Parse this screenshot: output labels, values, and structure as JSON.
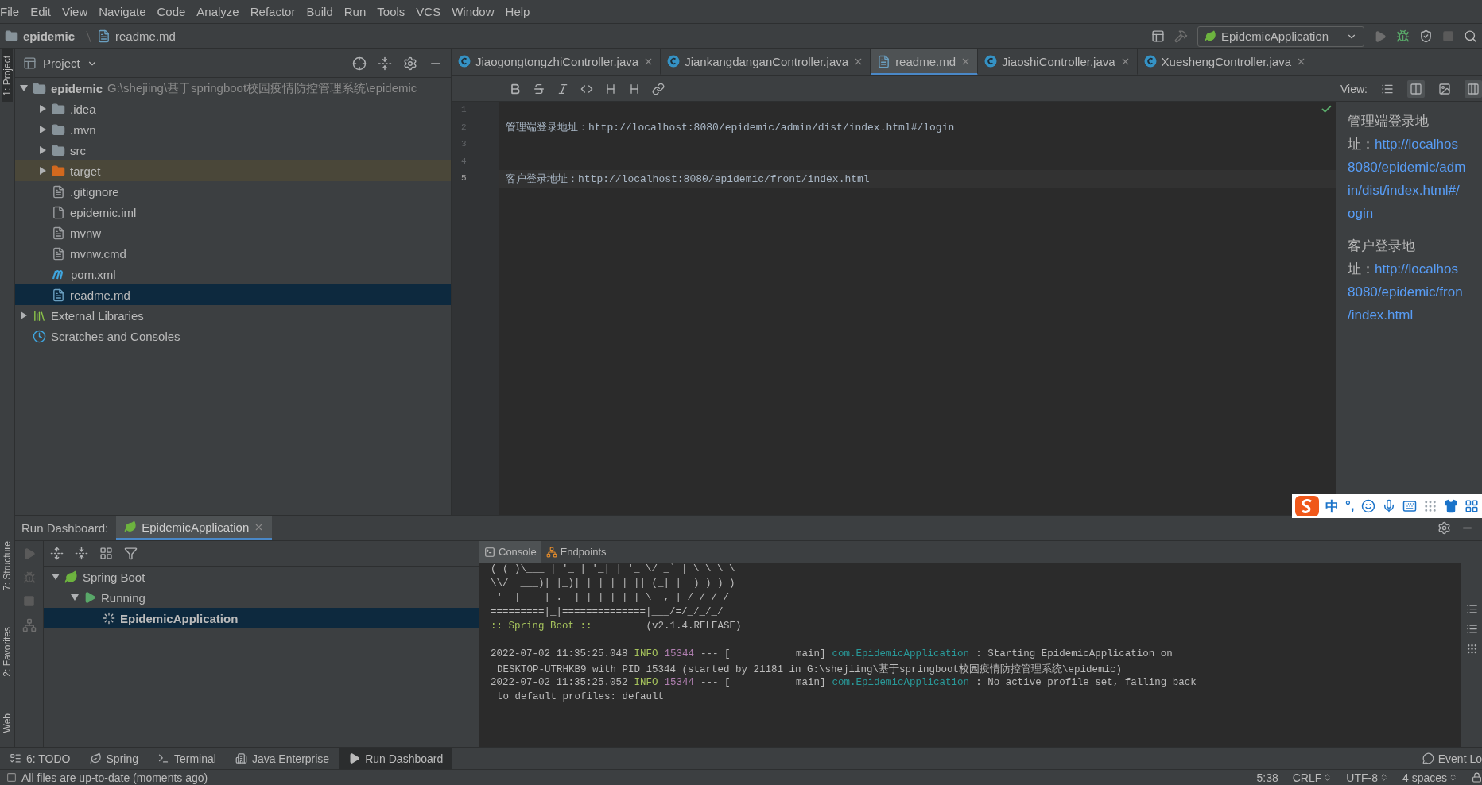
{
  "menu": [
    "File",
    "Edit",
    "View",
    "Navigate",
    "Code",
    "Analyze",
    "Refactor",
    "Build",
    "Run",
    "Tools",
    "VCS",
    "Window",
    "Help"
  ],
  "breadcrumb": [
    {
      "label": "epidemic",
      "kind": "module"
    },
    {
      "label": "readme.md",
      "kind": "markdown"
    }
  ],
  "run_config": {
    "label": "EpidemicApplication"
  },
  "left_stripe": {
    "top": [
      {
        "label": "1: Project",
        "selected": true
      }
    ],
    "bottom": [
      {
        "label": "7: Structure",
        "selected": false
      },
      {
        "label": "2: Favorites",
        "selected": false
      },
      {
        "label": "Web",
        "selected": false
      }
    ]
  },
  "project": {
    "title": "Project",
    "tree": [
      {
        "label": "epidemic",
        "path": "G:\\shejiing\\基于springboot校园疫情防控管理系统\\epidemic",
        "kind": "module",
        "expanded": true,
        "selected": false,
        "children": [
          {
            "label": ".idea",
            "kind": "folder",
            "expanded": false,
            "selected": false
          },
          {
            "label": ".mvn",
            "kind": "folder",
            "expanded": false,
            "selected": false
          },
          {
            "label": "src",
            "kind": "folder",
            "expanded": false,
            "selected": false
          },
          {
            "label": "target",
            "kind": "excluded-folder",
            "expanded": false,
            "selected": false
          },
          {
            "label": ".gitignore",
            "kind": "file",
            "selected": false
          },
          {
            "label": "epidemic.iml",
            "kind": "iml",
            "selected": false
          },
          {
            "label": "mvnw",
            "kind": "file",
            "selected": false
          },
          {
            "label": "mvnw.cmd",
            "kind": "file",
            "selected": false
          },
          {
            "label": "pom.xml",
            "kind": "maven",
            "selected": false
          },
          {
            "label": "readme.md",
            "kind": "markdown",
            "selected": true
          }
        ]
      },
      {
        "label": "External Libraries",
        "kind": "libraries",
        "expanded": false,
        "selected": false
      },
      {
        "label": "Scratches and Consoles",
        "kind": "scratches",
        "selected": false
      }
    ]
  },
  "editor": {
    "tabs": [
      {
        "label": "JiaogongtongzhiController.java",
        "kind": "class",
        "selected": false
      },
      {
        "label": "JiankangdanganController.java",
        "kind": "class",
        "selected": false
      },
      {
        "label": "readme.md",
        "kind": "markdown",
        "selected": true
      },
      {
        "label": "JiaoshiController.java",
        "kind": "class",
        "selected": false
      },
      {
        "label": "XueshengController.java",
        "kind": "class",
        "selected": false
      }
    ],
    "view_label": "View:",
    "lines": [
      {
        "number": "1",
        "current": false
      },
      {
        "number": "2",
        "text": "管理端登录地址：http://localhost:8080/epidemic/admin/dist/index.html#/login",
        "current": false
      },
      {
        "number": "3",
        "current": false
      },
      {
        "number": "4",
        "current": false
      },
      {
        "number": "5",
        "text": "客户登录地址：http://localhost:8080/epidemic/front/index.html",
        "current": true
      }
    ]
  },
  "preview": {
    "paragraphs": [
      {
        "lines": [
          [
            {
              "text": "管理端登录地",
              "link": false
            }
          ],
          [
            {
              "text": "址：",
              "link": false
            },
            {
              "text": "http://localhos",
              "link": true
            }
          ],
          [
            {
              "text": "8080/epidemic/adm",
              "link": true
            }
          ],
          [
            {
              "text": "in/dist/index.html#/",
              "link": true
            }
          ],
          [
            {
              "text": "ogin",
              "link": true
            }
          ]
        ]
      },
      {
        "lines": [
          [
            {
              "text": "客户登录地",
              "link": false
            }
          ],
          [
            {
              "text": "址：",
              "link": false
            },
            {
              "text": "http://localhos",
              "link": true
            }
          ],
          [
            {
              "text": "8080/epidemic/fron",
              "link": true
            }
          ],
          [
            {
              "text": "/index.html",
              "link": true
            }
          ]
        ]
      }
    ]
  },
  "ime": {
    "mode": "中",
    "punct": "°,"
  },
  "run_dashboard": {
    "title": "Run Dashboard:",
    "tabs": [
      {
        "label": "EpidemicApplication",
        "selected": true
      }
    ],
    "tree": [
      {
        "label": "Spring Boot",
        "kind": "spring",
        "expanded": true,
        "selected": false,
        "children": [
          {
            "label": "Running",
            "kind": "running",
            "expanded": true,
            "selected": false,
            "children": [
              {
                "label": "EpidemicApplication",
                "kind": "app",
                "selected": true
              }
            ]
          }
        ]
      }
    ],
    "console_tabs": [
      {
        "label": "Console",
        "kind": "console",
        "selected": true
      },
      {
        "label": "Endpoints",
        "kind": "endpoints",
        "selected": false
      }
    ],
    "console": {
      "banner": [
        {
          "segments": [
            {
              "text": "( ( )\\___ | '_ | '_| | '_ \\/ _` | \\ \\ \\ \\",
              "kind": "banner"
            }
          ]
        },
        {
          "segments": [
            {
              "text": "\\\\/  ___)| |_)| | | | | || (_| |  ) ) ) )",
              "kind": "banner"
            }
          ]
        },
        {
          "segments": [
            {
              "text": " '  |____| .__|_| |_|_| |_\\__, | / / / /",
              "kind": "banner"
            }
          ]
        },
        {
          "segments": [
            {
              "text": "=========|_|==============|___/=/_/_/_/",
              "kind": "banner"
            }
          ]
        },
        {
          "segments": [
            {
              "text": ":: Spring Boot ::",
              "kind": "spring"
            },
            {
              "text": "        (v2.1.4.RELEASE)",
              "kind": "banner"
            }
          ]
        }
      ],
      "log": [
        {
          "segments": [
            {
              "text": "2022-07-02 11:35:25.048",
              "kind": "timestamp"
            },
            {
              "text": "INFO",
              "kind": "level"
            },
            {
              "text": "15344",
              "kind": "pid"
            },
            {
              "text": "--- [           main]",
              "kind": "plain"
            },
            {
              "text": "com.EpidemicApplication",
              "kind": "logger"
            },
            {
              "text": ": Starting EpidemicApplication on",
              "kind": "message"
            }
          ]
        },
        {
          "segments": [
            {
              "text": "DESKTOP-UTRHKB9 with PID 15344 (started by 21181 in G:\\shejiing\\基于springboot校园疫情防控管理系统\\epidemic)",
              "kind": "continuation"
            }
          ]
        },
        {
          "segments": [
            {
              "text": "2022-07-02 11:35:25.052",
              "kind": "timestamp"
            },
            {
              "text": "INFO",
              "kind": "level"
            },
            {
              "text": "15344",
              "kind": "pid"
            },
            {
              "text": "--- [           main]",
              "kind": "plain"
            },
            {
              "text": "com.EpidemicApplication",
              "kind": "logger"
            },
            {
              "text": ": No active profile set, falling back",
              "kind": "message"
            }
          ]
        },
        {
          "segments": [
            {
              "text": "to default profiles: default",
              "kind": "continuation"
            }
          ]
        }
      ]
    }
  },
  "tool_windows": [
    {
      "label": "6: TODO",
      "kind": "todo",
      "selected": false
    },
    {
      "label": "Spring",
      "kind": "spring",
      "selected": false
    },
    {
      "label": "Terminal",
      "kind": "terminal",
      "selected": false
    },
    {
      "label": "Java Enterprise",
      "kind": "enterprise",
      "selected": false
    },
    {
      "label": "Run Dashboard",
      "kind": "run",
      "selected": true
    }
  ],
  "event_log": "Event Lo",
  "status": {
    "message": "All files are up-to-date (moments ago)",
    "position": "5:38",
    "items": [
      "CRLF",
      "UTF-8",
      "4 spaces"
    ]
  }
}
